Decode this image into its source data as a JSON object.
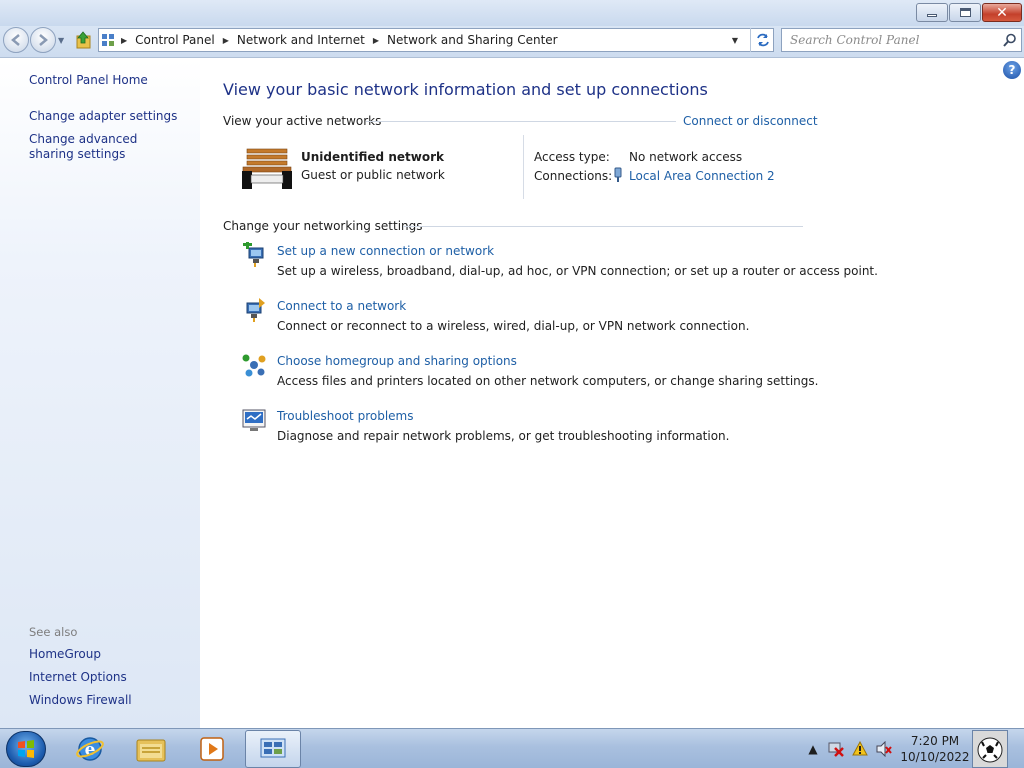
{
  "window": {
    "minimize_label": "Minimize",
    "maximize_label": "Maximize",
    "close_label": "Close"
  },
  "address_bar": {
    "breadcrumbs": [
      "Control Panel",
      "Network and Internet",
      "Network and Sharing Center"
    ]
  },
  "search": {
    "placeholder": "Search Control Panel"
  },
  "left_pane": {
    "home_link": "Control Panel Home",
    "links": [
      "Change adapter settings",
      "Change advanced sharing settings"
    ],
    "see_also_heading": "See also",
    "see_also_links": [
      "HomeGroup",
      "Internet Options",
      "Windows Firewall"
    ]
  },
  "main": {
    "title": "View your basic network information and set up connections",
    "active_networks": {
      "heading": "View your active networks",
      "connect_link": "Connect or disconnect",
      "network_name": "Unidentified network",
      "network_type": "Guest or public network",
      "access_type_label": "Access type:",
      "access_type_value": "No network access",
      "connections_label": "Connections:",
      "connections_value": "Local Area Connection 2"
    },
    "settings": {
      "heading": "Change your networking settings",
      "tasks": [
        {
          "title": "Set up a new connection or network",
          "desc": "Set up a wireless, broadband, dial-up, ad hoc, or VPN connection; or set up a router or access point."
        },
        {
          "title": "Connect to a network",
          "desc": "Connect or reconnect to a wireless, wired, dial-up, or VPN network connection."
        },
        {
          "title": "Choose homegroup and sharing options",
          "desc": "Access files and printers located on other network computers, or change sharing settings."
        },
        {
          "title": "Troubleshoot problems",
          "desc": "Diagnose and repair network problems, or get troubleshooting information."
        }
      ]
    }
  },
  "taskbar": {
    "time": "7:20 PM",
    "date": "10/10/2022"
  },
  "colors": {
    "link": "#1e5fa6",
    "title": "#1e3287",
    "taskbar": "#a9c0df"
  }
}
